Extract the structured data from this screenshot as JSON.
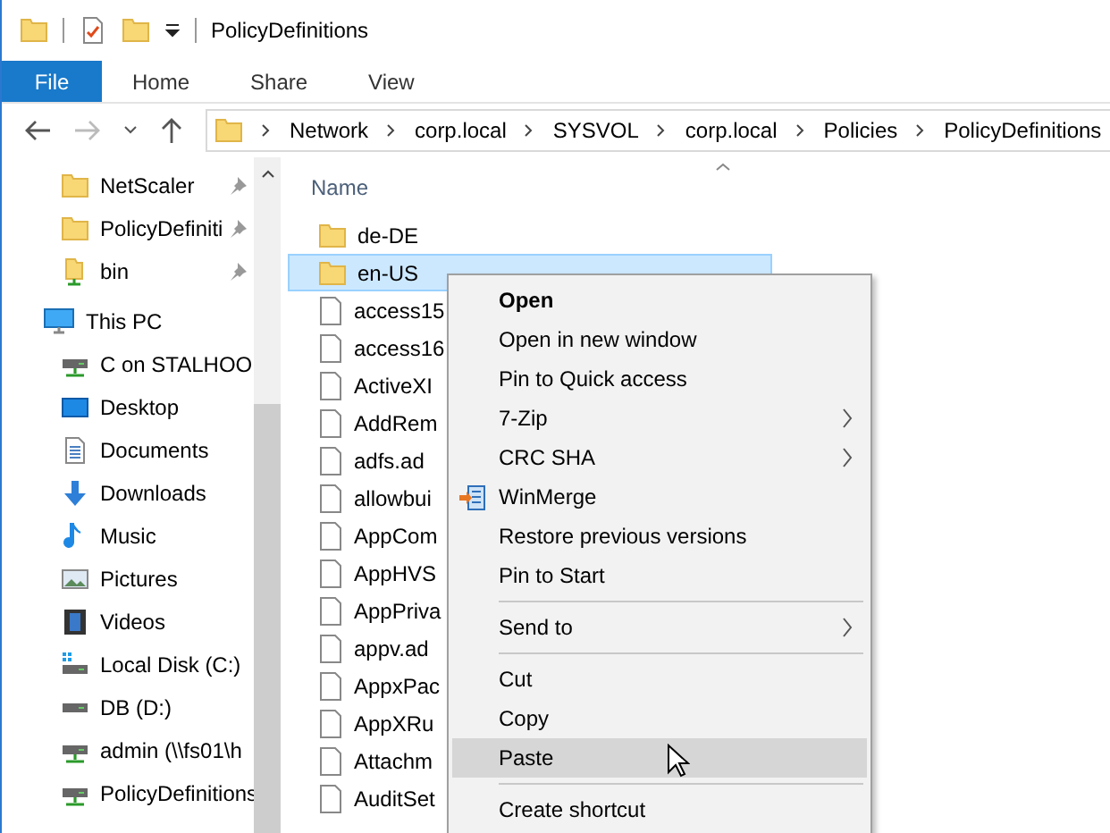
{
  "window": {
    "title": "PolicyDefinitions"
  },
  "ribbon_tabs": [
    {
      "label": "File",
      "selected": true
    },
    {
      "label": "Home",
      "selected": false
    },
    {
      "label": "Share",
      "selected": false
    },
    {
      "label": "View",
      "selected": false
    }
  ],
  "address_bar": {
    "path": [
      "Network",
      "corp.local",
      "SYSVOL",
      "corp.local",
      "Policies",
      "PolicyDefinitions"
    ]
  },
  "sidebar": {
    "quick_access": [
      {
        "label": "NetScaler",
        "kind": "folder",
        "pinned": true
      },
      {
        "label": "PolicyDefiniti",
        "kind": "folder",
        "pinned": true
      },
      {
        "label": "bin",
        "kind": "share",
        "pinned": true
      }
    ],
    "this_pc": {
      "label": "This PC",
      "children": [
        {
          "label": "C on STALHOO",
          "kind": "netdrive"
        },
        {
          "label": "Desktop",
          "kind": "desktop"
        },
        {
          "label": "Documents",
          "kind": "documents"
        },
        {
          "label": "Downloads",
          "kind": "downloads"
        },
        {
          "label": "Music",
          "kind": "music"
        },
        {
          "label": "Pictures",
          "kind": "pictures"
        },
        {
          "label": "Videos",
          "kind": "videos"
        },
        {
          "label": "Local Disk (C:)",
          "kind": "system"
        },
        {
          "label": "DB (D:)",
          "kind": "drive"
        },
        {
          "label": "admin (\\\\fs01\\h",
          "kind": "netdrive"
        },
        {
          "label": "PolicyDefinitions",
          "kind": "netdrive"
        }
      ]
    }
  },
  "file_list": {
    "column": "Name",
    "items": [
      {
        "name": "de-DE",
        "kind": "folder",
        "selected": false
      },
      {
        "name": "en-US",
        "kind": "folder",
        "selected": true
      },
      {
        "name": "access15",
        "kind": "file",
        "selected": false
      },
      {
        "name": "access16",
        "kind": "file",
        "selected": false
      },
      {
        "name": "ActiveXI",
        "kind": "file",
        "selected": false
      },
      {
        "name": "AddRem",
        "kind": "file",
        "selected": false
      },
      {
        "name": "adfs.ad",
        "kind": "file",
        "selected": false
      },
      {
        "name": "allowbui",
        "kind": "file",
        "selected": false
      },
      {
        "name": "AppCom",
        "kind": "file",
        "selected": false
      },
      {
        "name": "AppHVS",
        "kind": "file",
        "selected": false
      },
      {
        "name": "AppPriva",
        "kind": "file",
        "selected": false
      },
      {
        "name": "appv.ad",
        "kind": "file",
        "selected": false
      },
      {
        "name": "AppxPac",
        "kind": "file",
        "selected": false
      },
      {
        "name": "AppXRu",
        "kind": "file",
        "selected": false
      },
      {
        "name": "Attachm",
        "kind": "file",
        "selected": false
      },
      {
        "name": "AuditSet",
        "kind": "file",
        "selected": false
      }
    ]
  },
  "context_menu": [
    {
      "kind": "item",
      "label": "Open",
      "default": true,
      "submenu": false,
      "icon": false,
      "selected": false
    },
    {
      "kind": "item",
      "label": "Open in new window",
      "default": false,
      "submenu": false,
      "icon": false,
      "selected": false
    },
    {
      "kind": "item",
      "label": "Pin to Quick access",
      "default": false,
      "submenu": false,
      "icon": false,
      "selected": false
    },
    {
      "kind": "item",
      "label": "7-Zip",
      "default": false,
      "submenu": true,
      "icon": false,
      "selected": false
    },
    {
      "kind": "item",
      "label": "CRC SHA",
      "default": false,
      "submenu": true,
      "icon": false,
      "selected": false
    },
    {
      "kind": "item",
      "label": "WinMerge",
      "default": false,
      "submenu": false,
      "icon": true,
      "selected": false
    },
    {
      "kind": "item",
      "label": "Restore previous versions",
      "default": false,
      "submenu": false,
      "icon": false,
      "selected": false
    },
    {
      "kind": "item",
      "label": "Pin to Start",
      "default": false,
      "submenu": false,
      "icon": false,
      "selected": false
    },
    {
      "kind": "separator"
    },
    {
      "kind": "item",
      "label": "Send to",
      "default": false,
      "submenu": true,
      "icon": false,
      "selected": false
    },
    {
      "kind": "separator"
    },
    {
      "kind": "item",
      "label": "Cut",
      "default": false,
      "submenu": false,
      "icon": false,
      "selected": false
    },
    {
      "kind": "item",
      "label": "Copy",
      "default": false,
      "submenu": false,
      "icon": false,
      "selected": false
    },
    {
      "kind": "item",
      "label": "Paste",
      "default": false,
      "submenu": false,
      "icon": false,
      "selected": true
    },
    {
      "kind": "separator"
    },
    {
      "kind": "item",
      "label": "Create shortcut",
      "default": false,
      "submenu": false,
      "icon": false,
      "selected": false
    }
  ]
}
